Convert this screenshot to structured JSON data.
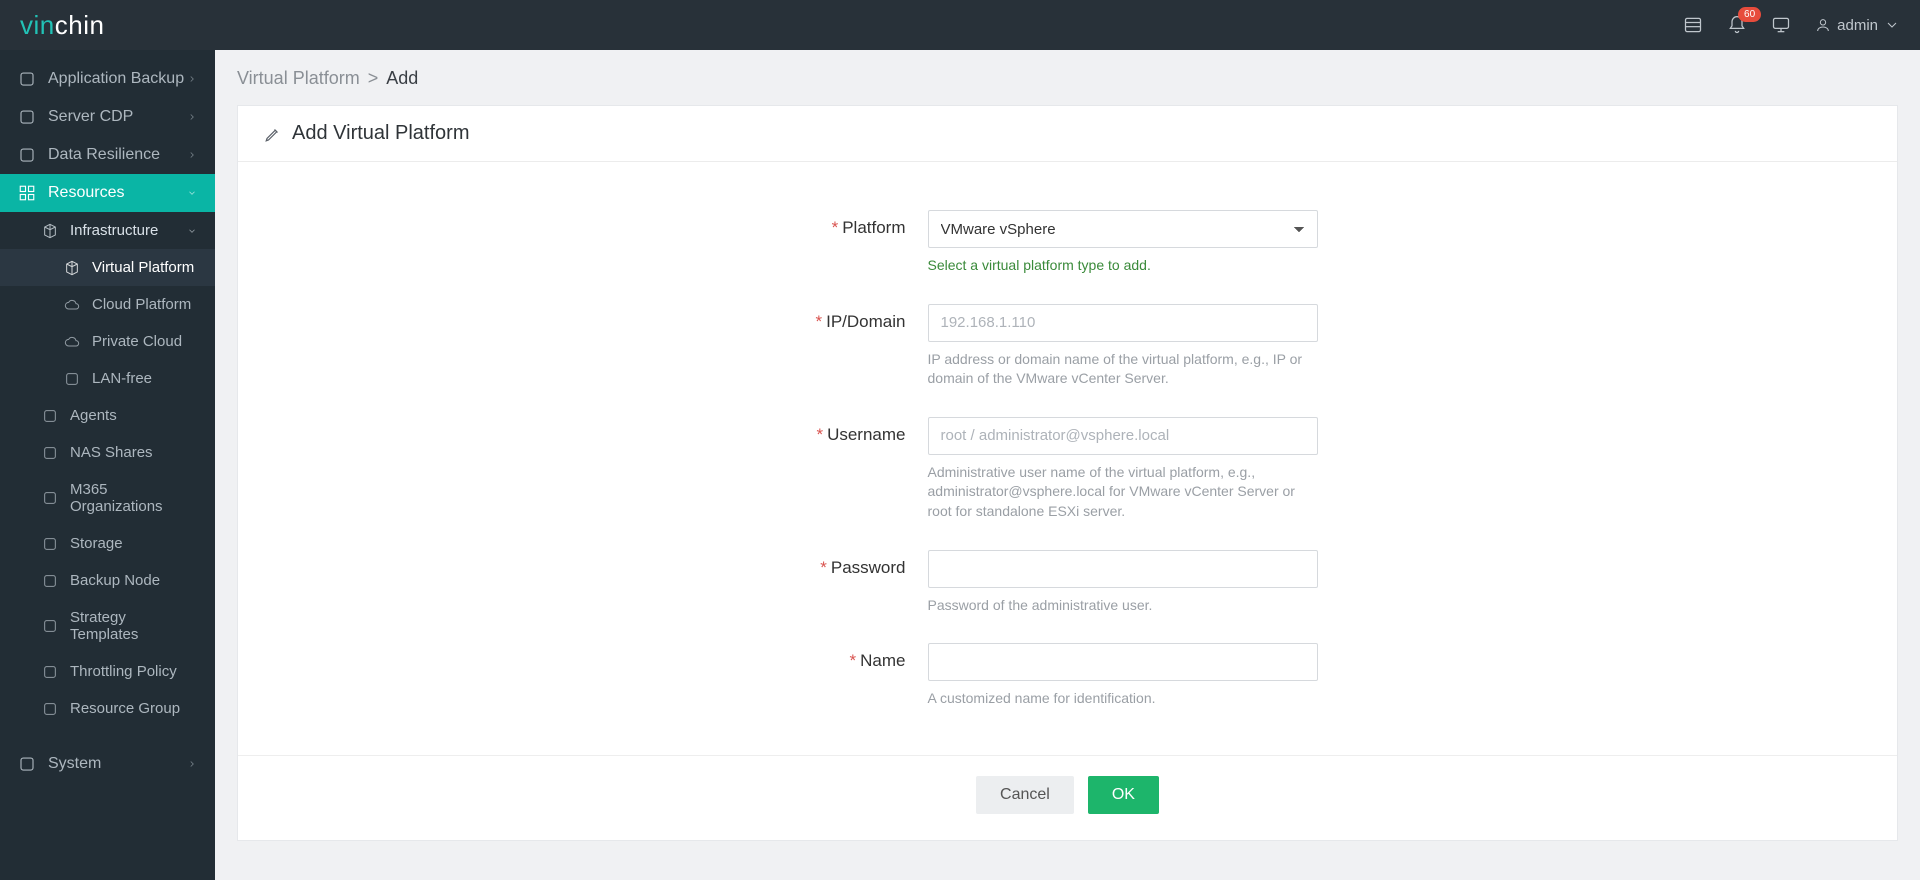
{
  "brand": {
    "part1": "vin",
    "part2": "chin"
  },
  "topbar": {
    "notification_count": "60",
    "user_label": "admin"
  },
  "sidebar": {
    "items": [
      {
        "label": "Application Backup",
        "level": 1,
        "chev": "right"
      },
      {
        "label": "Server CDP",
        "level": 1,
        "chev": "right"
      },
      {
        "label": "Data Resilience",
        "level": 1,
        "chev": "right"
      },
      {
        "label": "Resources",
        "level": 1,
        "chev": "down",
        "state": "expanded"
      },
      {
        "label": "Infrastructure",
        "level": 2,
        "chev": "down",
        "state": "sub-active"
      },
      {
        "label": "Virtual Platform",
        "level": 3,
        "state": "selected"
      },
      {
        "label": "Cloud Platform",
        "level": 3
      },
      {
        "label": "Private Cloud",
        "level": 3
      },
      {
        "label": "LAN-free",
        "level": 3
      },
      {
        "label": "Agents",
        "level": 2
      },
      {
        "label": "NAS Shares",
        "level": 2
      },
      {
        "label": "M365 Organizations",
        "level": 2
      },
      {
        "label": "Storage",
        "level": 2
      },
      {
        "label": "Backup Node",
        "level": 2
      },
      {
        "label": "Strategy Templates",
        "level": 2
      },
      {
        "label": "Throttling Policy",
        "level": 2
      },
      {
        "label": "Resource Group",
        "level": 2
      },
      {
        "label": "System",
        "level": 1,
        "chev": "right",
        "sep_before": true
      }
    ]
  },
  "breadcrumb": {
    "parent": "Virtual Platform",
    "sep": ">",
    "current": "Add"
  },
  "panel": {
    "title": "Add Virtual Platform"
  },
  "form": {
    "platform": {
      "label": "Platform",
      "value": "VMware vSphere",
      "help": "Select a virtual platform type to add."
    },
    "ipdomain": {
      "label": "IP/Domain",
      "placeholder": "192.168.1.110",
      "help": "IP address or domain name of the virtual platform, e.g., IP or domain of the VMware vCenter Server."
    },
    "username": {
      "label": "Username",
      "placeholder": "root / administrator@vsphere.local",
      "help": "Administrative user name of the virtual platform, e.g., administrator@vsphere.local for VMware vCenter Server or root for standalone ESXi server."
    },
    "password": {
      "label": "Password",
      "help": "Password of the administrative user."
    },
    "name": {
      "label": "Name",
      "help": "A customized name for identification."
    }
  },
  "buttons": {
    "cancel": "Cancel",
    "ok": "OK"
  }
}
